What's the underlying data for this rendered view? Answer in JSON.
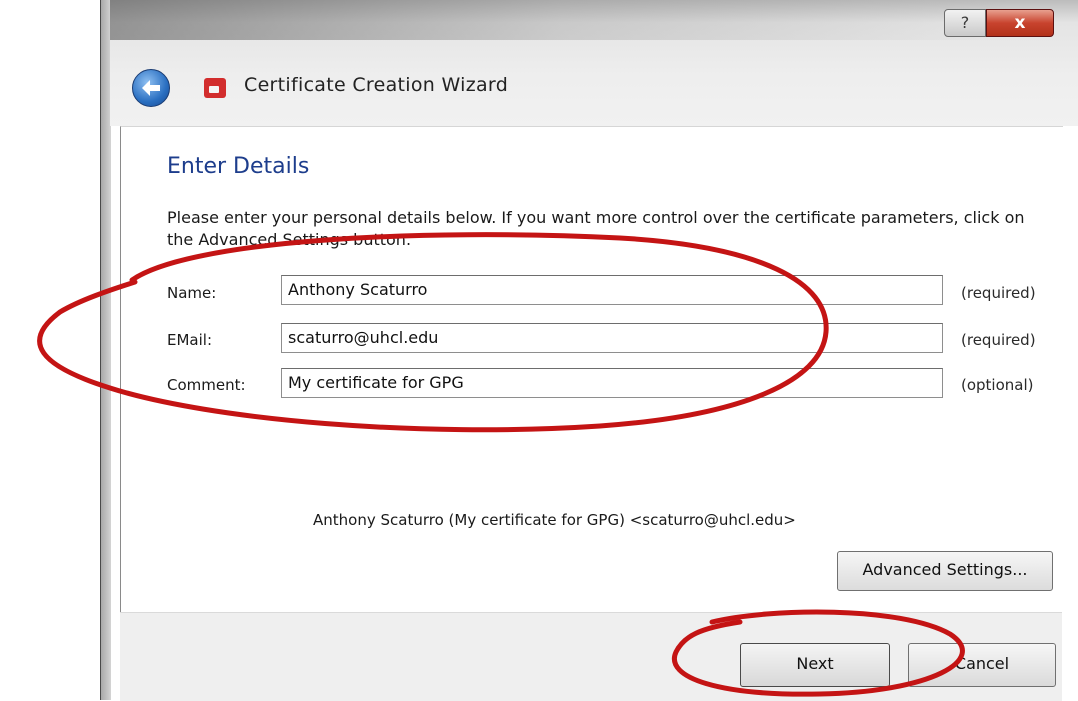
{
  "window": {
    "help_glyph": "?",
    "close_glyph": "x",
    "title": "Certificate Creation Wizard"
  },
  "page": {
    "heading": "Enter Details",
    "intro": "Please enter your personal details below. If you want more control over the certificate parameters, click on the Advanced Settings button."
  },
  "fields": [
    {
      "label": "Name:",
      "value": "Anthony Scaturro",
      "hint": "(required)"
    },
    {
      "label": "EMail:",
      "value": "scaturro@uhcl.edu",
      "hint": "(required)"
    },
    {
      "label": "Comment:",
      "value": "My certificate for GPG",
      "hint": "(optional)"
    }
  ],
  "preview": "Anthony Scaturro (My certificate for GPG) <scaturro@uhcl.edu>",
  "buttons": {
    "advanced": "Advanced Settings...",
    "next": "Next",
    "cancel": "Cancel"
  },
  "annotations": {
    "color": "#c41414"
  },
  "colors": {
    "heading": "#1d3d8c",
    "close_button": "#c8432e"
  }
}
